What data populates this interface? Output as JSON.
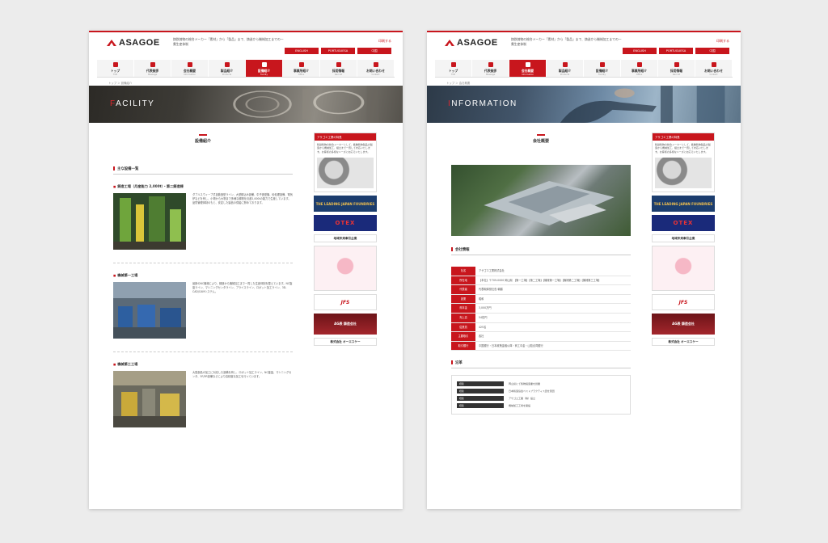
{
  "pages": {
    "a": {
      "brand": "ASAGOE",
      "tagline": "鋳鉄鋳物の総合メーカー「素材」から「製品」まで、鋳造から機械加工までの一貫生産体制",
      "print": "印刷する",
      "lang": [
        "ENGLISH",
        "PORTUGUESA",
        "中国"
      ],
      "nav": [
        {
          "label": "トップ",
          "sub": "TOP"
        },
        {
          "label": "代表挨拶",
          "sub": "Message"
        },
        {
          "label": "会社概要",
          "sub": "Information"
        },
        {
          "label": "製品紹介",
          "sub": "Products"
        },
        {
          "label": "設備紹介",
          "sub": "Facility"
        },
        {
          "label": "事業所紹介",
          "sub": "Office"
        },
        {
          "label": "採用情報",
          "sub": "Recruit"
        },
        {
          "label": "お問い合わせ",
          "sub": "Contact"
        }
      ],
      "breadcrumb": "トップ ＞ 設備紹介",
      "hero_cap": "F",
      "hero_rest": "ACILITY",
      "section_title": "設備紹介",
      "h2": "主な設備一覧",
      "facilities": [
        {
          "title": "鋳造工場（月産能力 2,000t）・第二鋳造棟",
          "text": "ダブルスウィーブ式自動造型ライン、大型鋳込み設備、中子造型機、砂処理設備、電気炉などを有し、小物から大物まで多様な鋳物を月産2,000tの能力で生産しています。品質管理体制のもと、安定した製品の供給に努めております。"
        },
        {
          "title": "機械第一工場",
          "text": "最新のNC機械により、鋳造から機械加工まで一貫した生産体制を整えています。NC旋盤ライン、マシニングセンタライン、ブライスライン、ロボット加工ライン、3D-CAD/CAMシステム。"
        },
        {
          "title": "機械第三工場",
          "text": "大型部品の加工に対応した設備を有し、ロボット加工ライン、NC旋盤、マシニングセンタ、5F/5R設備などにより高精度な加工を行っています。"
        }
      ],
      "side_head": "アサゴエ工業の特長",
      "side_text": "鋳鉄鋳物の総合メーカーとして、各種鋳物製品の製造から機械加工、組立まで一貫して対応いたします。お客様の多様なニーズにお応えいたします。",
      "banners": {
        "lead": "THE LEADING JAPAN FOUNDRIES",
        "otex": "OTEX",
        "region": "地域未来牽引企業",
        "jfs": "JFS",
        "ag": "AG表 鋳造会社",
        "osk": "株式会社 オーエスケー"
      }
    },
    "b": {
      "brand": "ASAGOE",
      "tagline": "鋳鉄鋳物の総合メーカー「素材」から「製品」まで、鋳造から機械加工までの一貫生産体制",
      "print": "印刷する",
      "lang": [
        "ENGLISH",
        "PORTUGUESA",
        "中国"
      ],
      "nav": [
        {
          "label": "トップ",
          "sub": "TOP"
        },
        {
          "label": "代表挨拶",
          "sub": "Message"
        },
        {
          "label": "会社概要",
          "sub": "Information"
        },
        {
          "label": "製品紹介",
          "sub": "Products"
        },
        {
          "label": "設備紹介",
          "sub": "Facility"
        },
        {
          "label": "事業所紹介",
          "sub": "Office"
        },
        {
          "label": "採用情報",
          "sub": "Recruit"
        },
        {
          "label": "お問い合わせ",
          "sub": "Contact"
        }
      ],
      "breadcrumb": "トップ ＞ 会社概要",
      "hero_cap": "I",
      "hero_rest": "NFORMATION",
      "section_title": "会社概要",
      "h2": "会社情報",
      "info_rows": [
        {
          "th": "社名",
          "td": "アサゴエ工業株式会社"
        },
        {
          "th": "所在地",
          "td": "【本社】〒709-0000 岡山県 【第一工場】【第二工場】【機械第一工場】【機械第二工場】【機械第三工場】"
        },
        {
          "th": "代表者",
          "td": "代表取締役社長 朝越"
        },
        {
          "th": "創業",
          "td": "昭和"
        },
        {
          "th": "資本金",
          "td": "3,000万円"
        },
        {
          "th": "売上高",
          "td": "54億円"
        },
        {
          "th": "従業員",
          "td": "425名"
        },
        {
          "th": "主要取引",
          "td": "各社"
        },
        {
          "th": "取引銀行",
          "td": "中国銀行・日本政策金融公庫・商工中金・山陰合同銀行"
        }
      ],
      "h2_history": "沿革",
      "history": [
        {
          "date": "昭和",
          "text": "岡山県にて鋳物製造業を創業"
        },
        {
          "date": "昭和",
          "text": "日本鋳造協会ベストプラクティス賞を受賞"
        },
        {
          "date": "昭和",
          "text": "アサゴエ工業（株）設立"
        },
        {
          "date": "昭和",
          "text": "機械加工工場を開設"
        }
      ],
      "side_head": "アサゴエ工業の特長",
      "side_text": "鋳鉄鋳物の総合メーカーとして、各種鋳物製品の製造から機械加工、組立まで一貫して対応いたします。お客様の多様なニーズにお応えいたします。",
      "banners": {
        "lead": "THE LEADING JAPAN FOUNDRIES",
        "otex": "OTEX",
        "region": "地域未来牽引企業",
        "jfs": "JFS",
        "ag": "AG表 鋳造会社",
        "osk": "株式会社 オーエスケー"
      }
    }
  },
  "colors": {
    "accent": "#c8161d"
  }
}
